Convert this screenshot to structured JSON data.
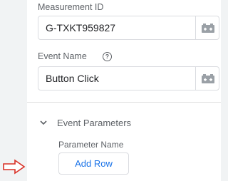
{
  "measurement": {
    "label": "Measurement ID",
    "value": "G-TXKT959827"
  },
  "event_name": {
    "label": "Event Name",
    "value": "Button Click",
    "help_glyph": "?"
  },
  "event_parameters": {
    "title": "Event Parameters",
    "expanded": true,
    "parameter_name_label": "Parameter Name",
    "add_row_label": "Add Row"
  },
  "icons": {
    "variable": "variable-picker-icon",
    "chevron": "chevron-down-icon",
    "arrow": "right-arrow-annotation-icon"
  },
  "colors": {
    "accent": "#1a73e8",
    "arrow": "#d93025",
    "icon": "#9aa0a6"
  }
}
